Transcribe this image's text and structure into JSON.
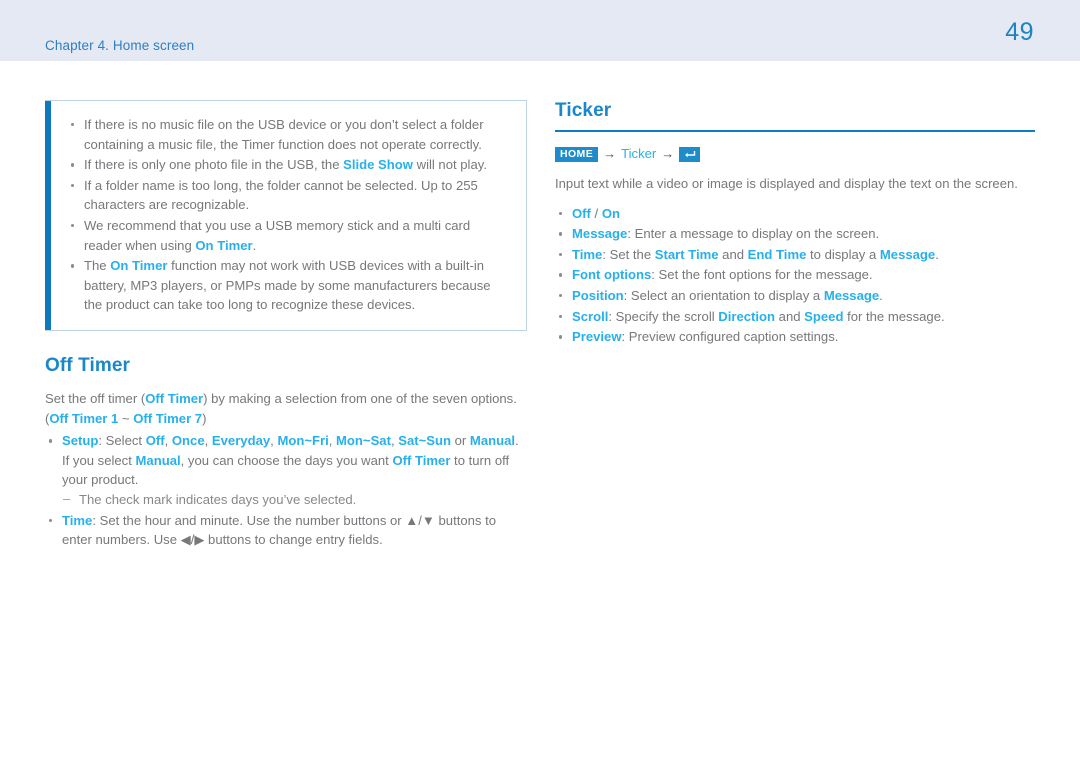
{
  "header": {
    "chapter": "Chapter 4. Home screen",
    "page_number": "49"
  },
  "colors": {
    "header_band": "#e4e9f4",
    "accent_bar": "#1078bd",
    "heading_blue": "#1a87c9",
    "keyword_blue": "#28b0ea",
    "body_gray": "#76787b",
    "rule_blue": "#0f7dc2",
    "badge_blue": "#1e8ccb"
  },
  "note_box": {
    "items": [
      {
        "parts": [
          {
            "t": "If there is no music file on the USB device or you don’t select a folder containing a music file, the Timer function does not operate correctly.",
            "k": false
          }
        ]
      },
      {
        "parts": [
          {
            "t": "If there is only one photo file in the USB, the ",
            "k": false
          },
          {
            "t": "Slide Show",
            "k": true
          },
          {
            "t": " will not play.",
            "k": false
          }
        ]
      },
      {
        "parts": [
          {
            "t": "If a folder name is too long, the folder cannot be selected. Up to 255 characters are recognizable.",
            "k": false
          }
        ]
      },
      {
        "parts": [
          {
            "t": "We recommend that you use a USB memory stick and a multi card reader when using ",
            "k": false
          },
          {
            "t": "On Timer",
            "k": true
          },
          {
            "t": ".",
            "k": false
          }
        ]
      },
      {
        "parts": [
          {
            "t": "The ",
            "k": false
          },
          {
            "t": "On Timer",
            "k": true
          },
          {
            "t": " function may not work with USB devices with a built-in battery, MP3 players, or PMPs made by some manufacturers because the product can take too long to recognize these devices.",
            "k": false
          }
        ]
      }
    ]
  },
  "off_timer": {
    "title": "Off Timer",
    "intro": {
      "parts": [
        {
          "t": "Set the off timer (",
          "k": false
        },
        {
          "t": "Off Timer",
          "k": true
        },
        {
          "t": ") by making a selection from one of the seven options. (",
          "k": false
        },
        {
          "t": "Off Timer 1",
          "k": true
        },
        {
          "t": " ~ ",
          "k": false
        },
        {
          "t": "Off Timer 7",
          "k": true
        },
        {
          "t": ")",
          "k": false
        }
      ]
    },
    "items": [
      {
        "parts": [
          {
            "t": "Setup",
            "k": true
          },
          {
            "t": ": Select ",
            "k": false
          },
          {
            "t": "Off",
            "k": true
          },
          {
            "t": ", ",
            "k": false
          },
          {
            "t": "Once",
            "k": true
          },
          {
            "t": ", ",
            "k": false
          },
          {
            "t": "Everyday",
            "k": true
          },
          {
            "t": ", ",
            "k": false
          },
          {
            "t": "Mon~Fri",
            "k": true
          },
          {
            "t": ", ",
            "k": false
          },
          {
            "t": "Mon~Sat",
            "k": true
          },
          {
            "t": ", ",
            "k": false
          },
          {
            "t": "Sat~Sun",
            "k": true
          },
          {
            "t": " or ",
            "k": false
          },
          {
            "t": "Manual",
            "k": true
          },
          {
            "t": ".",
            "k": false
          },
          {
            "t": "\n",
            "k": false
          },
          {
            "t": "If you select ",
            "k": false
          },
          {
            "t": "Manual",
            "k": true
          },
          {
            "t": ", you can choose the days you want ",
            "k": false
          },
          {
            "t": "Off Timer",
            "k": true
          },
          {
            "t": " to turn off your product.",
            "k": false
          }
        ],
        "sub": [
          {
            "parts": [
              {
                "t": "The check mark indicates days you’ve selected.",
                "k": false
              }
            ]
          }
        ]
      },
      {
        "parts": [
          {
            "t": "Time",
            "k": true
          },
          {
            "t": ": Set the hour and minute. Use the number buttons or ▲/▼ buttons to enter numbers. Use ◀/▶ buttons to change entry fields.",
            "k": false
          }
        ],
        "sub": []
      }
    ]
  },
  "ticker": {
    "title": "Ticker",
    "breadcrumb": {
      "home_label": "HOME",
      "arrow": "→",
      "link_label": "Ticker",
      "enter_icon_name": "enter-key-icon"
    },
    "intro": "Input text while a video or image is displayed and display the text on the screen.",
    "items": [
      {
        "parts": [
          {
            "t": "Off",
            "k": true
          },
          {
            "t": " / ",
            "k": false
          },
          {
            "t": "On",
            "k": true
          }
        ]
      },
      {
        "parts": [
          {
            "t": "Message",
            "k": true
          },
          {
            "t": ": Enter a message to display on the screen.",
            "k": false
          }
        ]
      },
      {
        "parts": [
          {
            "t": "Time",
            "k": true
          },
          {
            "t": ": Set the ",
            "k": false
          },
          {
            "t": "Start Time",
            "k": true
          },
          {
            "t": " and ",
            "k": false
          },
          {
            "t": "End Time",
            "k": true
          },
          {
            "t": " to display a ",
            "k": false
          },
          {
            "t": "Message",
            "k": true
          },
          {
            "t": ".",
            "k": false
          }
        ]
      },
      {
        "parts": [
          {
            "t": "Font options",
            "k": true
          },
          {
            "t": ": Set the font options for the message.",
            "k": false
          }
        ]
      },
      {
        "parts": [
          {
            "t": "Position",
            "k": true
          },
          {
            "t": ": Select an orientation to display a ",
            "k": false
          },
          {
            "t": "Message",
            "k": true
          },
          {
            "t": ".",
            "k": false
          }
        ]
      },
      {
        "parts": [
          {
            "t": "Scroll",
            "k": true
          },
          {
            "t": ": Specify the scroll ",
            "k": false
          },
          {
            "t": "Direction",
            "k": true
          },
          {
            "t": " and ",
            "k": false
          },
          {
            "t": "Speed",
            "k": true
          },
          {
            "t": " for the message.",
            "k": false
          }
        ]
      },
      {
        "parts": [
          {
            "t": "Preview",
            "k": true
          },
          {
            "t": ": Preview configured caption settings.",
            "k": false
          }
        ]
      }
    ]
  }
}
